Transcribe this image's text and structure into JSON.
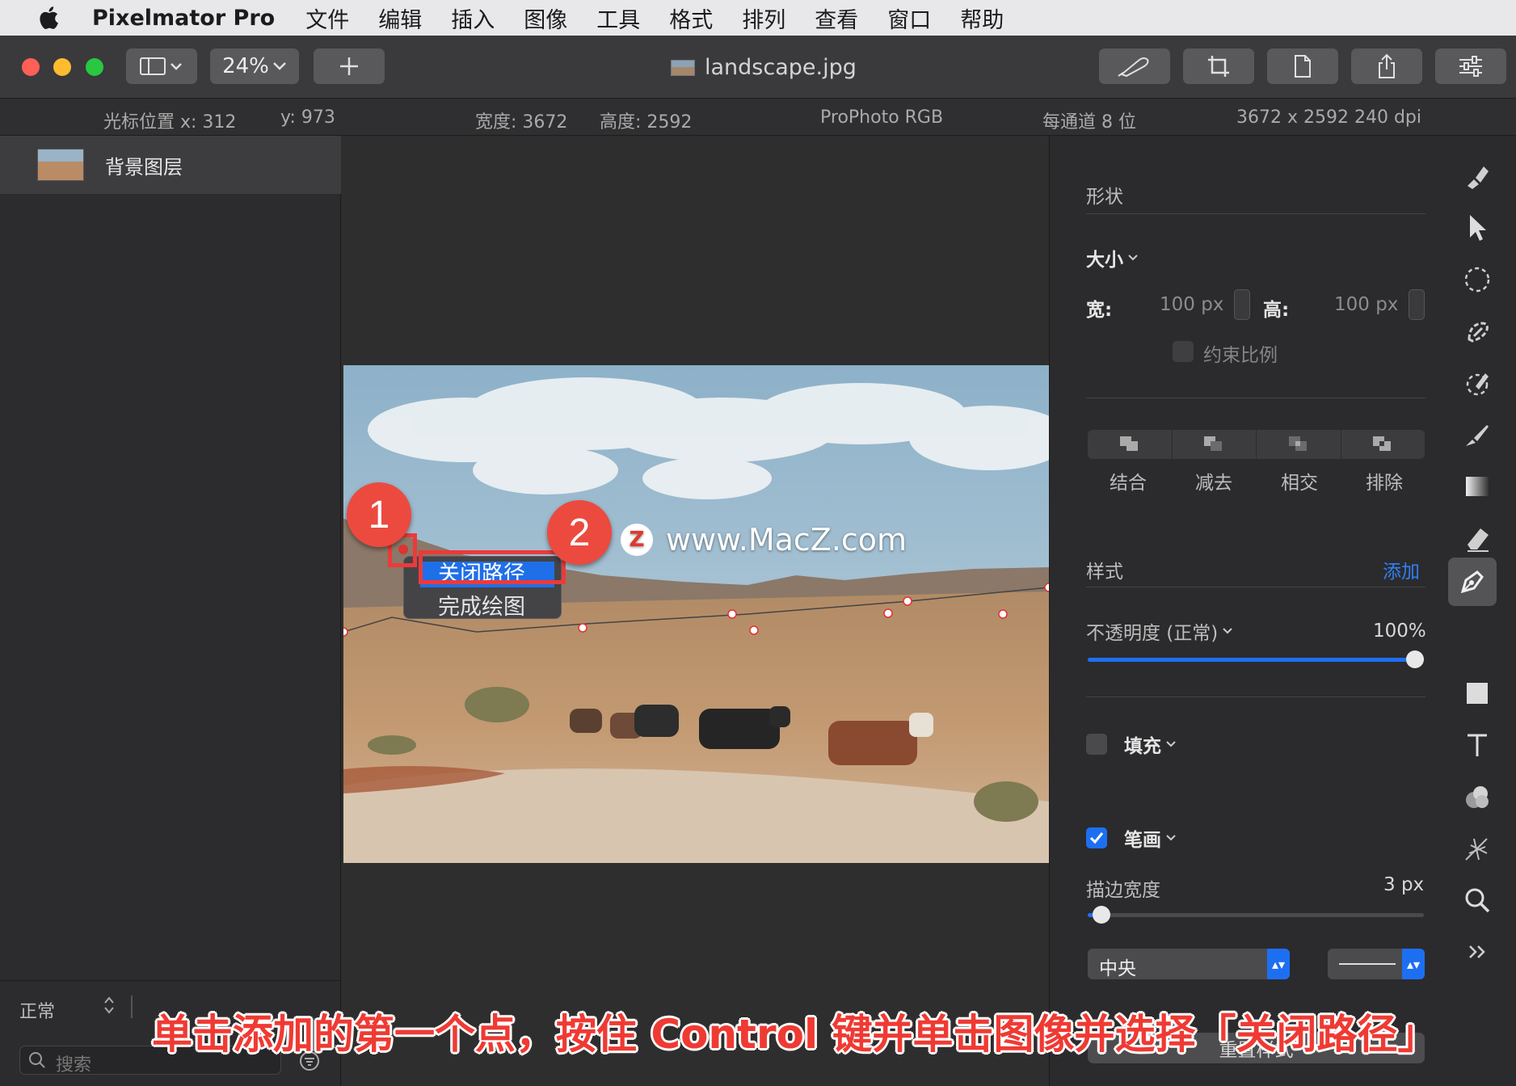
{
  "menubar": {
    "app_name": "Pixelmator Pro",
    "items": [
      "文件",
      "编辑",
      "插入",
      "图像",
      "工具",
      "格式",
      "排列",
      "查看",
      "窗口",
      "帮助"
    ]
  },
  "toolbar": {
    "zoom": "24%",
    "doc_title": "landscape.jpg"
  },
  "infobar": {
    "cursor_x": "光标位置 x:  312",
    "cursor_y": "y:  973",
    "width": "宽度:  3672",
    "height": "高度:  2592",
    "color_profile": "ProPhoto RGB",
    "bit_depth": "每通道 8 位",
    "resolution": "3672 x 2592 240 dpi"
  },
  "layers": {
    "items": [
      {
        "name": "背景图层"
      }
    ],
    "blend_mode": "正常",
    "search_placeholder": "搜索"
  },
  "context_menu": {
    "item1": "关闭路径",
    "item2": "完成绘图"
  },
  "badges": {
    "b1": "1",
    "b2": "2"
  },
  "watermark": "www.MacZ.com",
  "watermark_logo": "Z",
  "right_panel": {
    "section_shape": "形状",
    "size_label": "大小",
    "width_label": "宽:",
    "width_value": "100 px",
    "height_label": "高:",
    "height_value": "100 px",
    "constrain": "约束比例",
    "ops": [
      "结合",
      "减去",
      "相交",
      "排除"
    ],
    "style_label": "样式",
    "add_label": "添加",
    "opacity_label": "不透明度 (正常)",
    "opacity_value": "100%",
    "opacity_level": 1.0,
    "fill_label": "填充",
    "fill_checked": false,
    "stroke_label": "笔画",
    "stroke_checked": true,
    "stroke_width_label": "描边宽度",
    "stroke_width_value": "3 px",
    "stroke_width_level": 0.04,
    "stroke_position": "中央",
    "reset_label": "重置样式"
  },
  "caption": "单击添加的第一个点，按住 Control 键并单击图像并选择「关闭路径」",
  "colors": {
    "accent": "#1d6ff2",
    "badge": "#ec4a3f",
    "caption": "#ef3a33"
  }
}
